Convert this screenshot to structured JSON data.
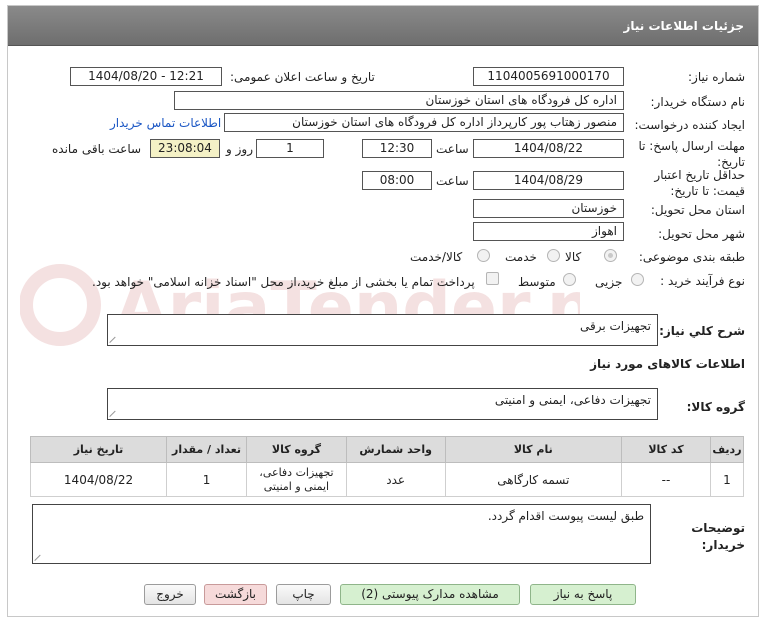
{
  "header": {
    "title": "جزئیات اطلاعات نیاز"
  },
  "fields": {
    "need_number_label": "شماره نیاز:",
    "need_number": "1104005691000170",
    "announce_label": "تاریخ و ساعت اعلان عمومی:",
    "announce_value": "1404/08/20 - 12:21",
    "buyer_label": "نام دستگاه خریدار:",
    "buyer_value": "اداره کل فرودگاه های استان خوزستان",
    "creator_label": "ایجاد کننده درخواست:",
    "creator_value": "منصور زهتاب پور کارپرداز اداره کل فرودگاه های استان خوزستان",
    "contact_link": "اطلاعات تماس خریدار",
    "reply_deadline_label": "مهلت ارسال پاسخ: تا تاریخ:",
    "reply_date": "1404/08/22",
    "time_label": "ساعت",
    "reply_time": "12:30",
    "days_value": "1",
    "days_label": "روز و",
    "remaining_time": "23:08:04",
    "remaining_label": "ساعت باقی مانده",
    "price_validity_label": "حداقل تاریخ اعتبار قیمت: تا تاریخ:",
    "validity_date": "1404/08/29",
    "validity_time": "08:00",
    "province_label": "استان محل تحویل:",
    "province_value": "خوزستان",
    "city_label": "شهر محل تحویل:",
    "city_value": "اهواز",
    "category_label": "طبقه بندی موضوعی:",
    "category_options": [
      "کالا",
      "خدمت",
      "کالا/خدمت"
    ],
    "category_selected": "کالا",
    "process_label": "نوع فرآیند خرید :",
    "process_options": [
      "جزیی",
      "متوسط"
    ],
    "payment_note": "پرداخت تمام یا بخشی از مبلغ خرید،از محل \"اسناد خزانه اسلامی\" خواهد بود."
  },
  "description": {
    "label": "شرح کلي نياز:",
    "value": "تجهیزات برقی"
  },
  "goods_section": {
    "title": "اطلاعات کالاهای مورد نیاز"
  },
  "goods_group": {
    "label": "گروه کالا:",
    "value": "تجهیزات دفاعی، ایمنی و امنیتی"
  },
  "table": {
    "headers": [
      "ردیف",
      "کد کالا",
      "نام کالا",
      "واحد شمارش",
      "گروه کالا",
      "تعداد / مقدار",
      "تاریخ نیاز"
    ],
    "rows": [
      [
        "1",
        "--",
        "تسمه کارگاهی",
        "عدد",
        "تجهیزات دفاعی، ایمنی و امنیتی",
        "1",
        "1404/08/22"
      ]
    ]
  },
  "buyer_notes": {
    "label": "توضیحات خریدار:",
    "value": "طبق لیست پیوست اقدام گردد."
  },
  "buttons": {
    "reply": "پاسخ به نیاز",
    "attachments": "مشاهده مدارک پیوستی (2)",
    "print": "چاپ",
    "back": "بازگشت",
    "exit": "خروج"
  },
  "watermark": {
    "text": "AriaTender.net",
    "color": "#b01e1e"
  }
}
